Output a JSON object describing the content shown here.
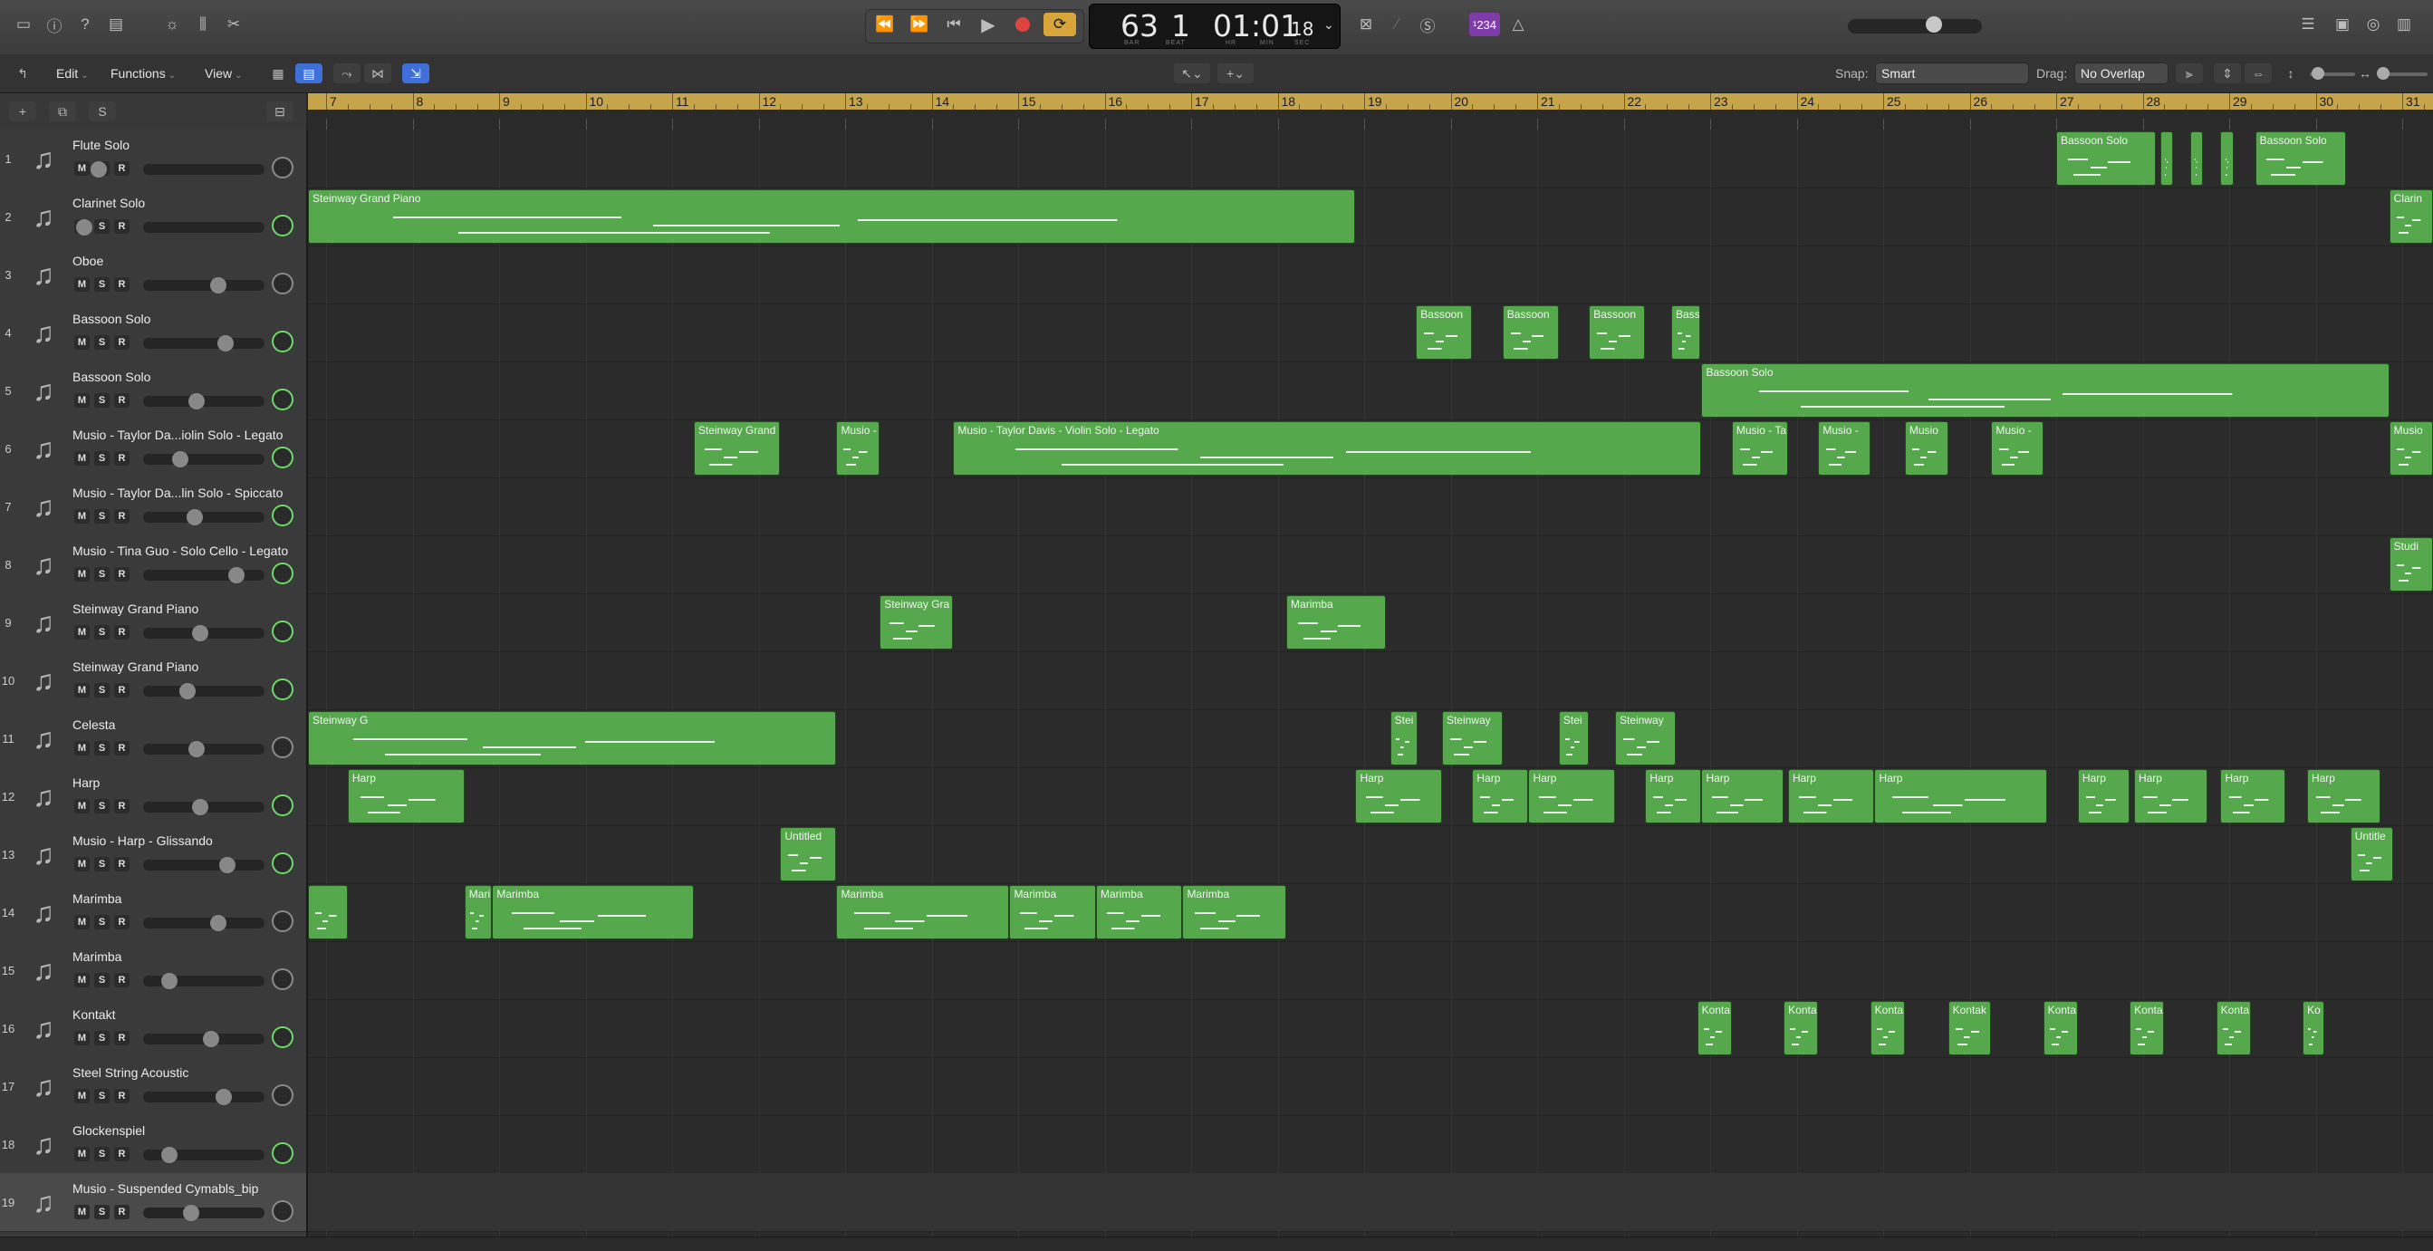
{
  "lcd": {
    "bar": "63",
    "beat": "1",
    "time": "01:01",
    "frames": "18",
    "labels": {
      "bar": "BAR",
      "beat": "BEAT",
      "hr": "HR",
      "min": "MIN",
      "sec": "SEC"
    }
  },
  "transport": {
    "signature_badge": "¹234"
  },
  "toolbar": {
    "edit_label": "Edit",
    "functions_label": "Functions",
    "view_label": "View",
    "snap_label": "Snap:",
    "snap_value": "Smart",
    "drag_label": "Drag:",
    "drag_value": "No Overlap"
  },
  "header_buttons": {
    "add": "+",
    "s": "S"
  },
  "ruler_bars": [
    "7",
    "8",
    "9",
    "10",
    "11",
    "12",
    "13",
    "14",
    "15",
    "16",
    "17",
    "18",
    "19",
    "20",
    "21",
    "22",
    "23",
    "24",
    "25",
    "26",
    "27",
    "28",
    "29",
    "30",
    "31"
  ],
  "tracks": [
    {
      "num": "1",
      "name": "Flute Solo",
      "icon": "flute-icon",
      "pan_active": false
    },
    {
      "num": "2",
      "name": "Clarinet Solo",
      "icon": "clarinet-icon",
      "pan_active": true
    },
    {
      "num": "3",
      "name": "Oboe",
      "icon": "oboe-icon",
      "pan_active": false
    },
    {
      "num": "4",
      "name": "Bassoon Solo",
      "icon": "bassoon-icon",
      "pan_active": true
    },
    {
      "num": "5",
      "name": "Bassoon Solo",
      "icon": "bassoon-icon",
      "pan_active": true
    },
    {
      "num": "6",
      "name": "Musio - Taylor Da...iolin Solo - Legato",
      "icon": "violin-icon",
      "pan_active": true
    },
    {
      "num": "7",
      "name": "Musio - Taylor Da...lin Solo - Spiccato",
      "icon": "violin-icon",
      "pan_active": true
    },
    {
      "num": "8",
      "name": "Musio - Tina Guo - Solo Cello - Legato",
      "icon": "cello-icon",
      "pan_active": true
    },
    {
      "num": "9",
      "name": "Steinway Grand Piano",
      "icon": "grand-piano-icon",
      "pan_active": true
    },
    {
      "num": "10",
      "name": "Steinway Grand Piano",
      "icon": "grand-piano-icon",
      "pan_active": true
    },
    {
      "num": "11",
      "name": "Celesta",
      "icon": "celesta-icon",
      "pan_active": false
    },
    {
      "num": "12",
      "name": "Harp",
      "icon": "harp-icon",
      "pan_active": true
    },
    {
      "num": "13",
      "name": "Musio - Harp - Glissando",
      "icon": "harp-icon",
      "pan_active": true
    },
    {
      "num": "14",
      "name": "Marimba",
      "icon": "marimba-icon",
      "pan_active": false
    },
    {
      "num": "15",
      "name": "Marimba",
      "icon": "marimba-icon",
      "pan_active": false
    },
    {
      "num": "16",
      "name": "Kontakt",
      "icon": "guitar-icon",
      "pan_active": true
    },
    {
      "num": "17",
      "name": "Steel String Acoustic",
      "icon": "acoustic-guitar-icon",
      "pan_active": false
    },
    {
      "num": "18",
      "name": "Glockenspiel",
      "icon": "glockenspiel-icon",
      "pan_active": true
    },
    {
      "num": "19",
      "name": "Musio - Suspended Cymabls_bip",
      "icon": "cymbal-icon",
      "pan_active": false
    }
  ],
  "msr": {
    "m": "M",
    "s": "S",
    "r": "R"
  },
  "regions": [
    {
      "track": 0,
      "start": 27.0,
      "end": 28.15,
      "label": "Bassoon Solo"
    },
    {
      "track": 0,
      "start": 28.2,
      "end": 28.35,
      "label": ""
    },
    {
      "track": 0,
      "start": 28.55,
      "end": 28.7,
      "label": ""
    },
    {
      "track": 0,
      "start": 28.9,
      "end": 29.05,
      "label": ""
    },
    {
      "track": 0,
      "start": 29.3,
      "end": 30.35,
      "label": "Bassoon Solo"
    },
    {
      "track": 1,
      "start": 6.72,
      "end": 18.9,
      "label": "Steinway Grand Piano"
    },
    {
      "track": 1,
      "start": 30.85,
      "end": 31.5,
      "label": "Clarin"
    },
    {
      "track": 3,
      "start": 19.6,
      "end": 20.25,
      "label": "Bassoon"
    },
    {
      "track": 3,
      "start": 20.6,
      "end": 21.25,
      "label": "Bassoon"
    },
    {
      "track": 3,
      "start": 21.6,
      "end": 22.25,
      "label": "Bassoon"
    },
    {
      "track": 3,
      "start": 22.55,
      "end": 22.88,
      "label": "Bass"
    },
    {
      "track": 4,
      "start": 22.9,
      "end": 30.85,
      "label": "Bassoon Solo"
    },
    {
      "track": 5,
      "start": 11.25,
      "end": 12.25,
      "label": "Steinway Grand"
    },
    {
      "track": 5,
      "start": 12.9,
      "end": 13.4,
      "label": "Musio -"
    },
    {
      "track": 5,
      "start": 14.25,
      "end": 22.9,
      "label": "Musio - Taylor Davis - Violin Solo - Legato"
    },
    {
      "track": 5,
      "start": 23.25,
      "end": 23.9,
      "label": "Musio - Ta"
    },
    {
      "track": 5,
      "start": 24.25,
      "end": 24.85,
      "label": "Musio -"
    },
    {
      "track": 5,
      "start": 25.25,
      "end": 25.75,
      "label": "Musio"
    },
    {
      "track": 5,
      "start": 26.25,
      "end": 26.85,
      "label": "Musio -"
    },
    {
      "track": 5,
      "start": 30.85,
      "end": 31.5,
      "label": "Musio"
    },
    {
      "track": 7,
      "start": 30.85,
      "end": 31.5,
      "label": "Studi"
    },
    {
      "track": 8,
      "start": 13.4,
      "end": 14.25,
      "label": "Steinway Gra"
    },
    {
      "track": 8,
      "start": 18.1,
      "end": 19.25,
      "label": "Marimba"
    },
    {
      "track": 10,
      "start": 6.72,
      "end": 12.9,
      "label": "Steinway G"
    },
    {
      "track": 10,
      "start": 19.3,
      "end": 19.62,
      "label": "Stei"
    },
    {
      "track": 10,
      "start": 19.9,
      "end": 20.6,
      "label": "Steinway"
    },
    {
      "track": 10,
      "start": 21.25,
      "end": 21.6,
      "label": "Stei"
    },
    {
      "track": 10,
      "start": 21.9,
      "end": 22.6,
      "label": "Steinway"
    },
    {
      "track": 11,
      "start": 7.25,
      "end": 8.6,
      "label": "Harp"
    },
    {
      "track": 11,
      "start": 18.9,
      "end": 19.9,
      "label": "Harp"
    },
    {
      "track": 11,
      "start": 20.25,
      "end": 20.9,
      "label": "Harp"
    },
    {
      "track": 11,
      "start": 20.9,
      "end": 21.9,
      "label": "Harp"
    },
    {
      "track": 11,
      "start": 22.25,
      "end": 22.9,
      "label": "Harp"
    },
    {
      "track": 11,
      "start": 22.9,
      "end": 23.85,
      "label": "Harp"
    },
    {
      "track": 11,
      "start": 23.9,
      "end": 24.9,
      "label": "Harp"
    },
    {
      "track": 11,
      "start": 24.9,
      "end": 26.9,
      "label": "Harp"
    },
    {
      "track": 11,
      "start": 27.25,
      "end": 27.85,
      "label": "Harp"
    },
    {
      "track": 11,
      "start": 27.9,
      "end": 28.75,
      "label": "Harp"
    },
    {
      "track": 11,
      "start": 28.9,
      "end": 29.65,
      "label": "Harp"
    },
    {
      "track": 11,
      "start": 29.9,
      "end": 30.75,
      "label": "Harp"
    },
    {
      "track": 12,
      "start": 12.25,
      "end": 12.9,
      "label": "Untitled"
    },
    {
      "track": 12,
      "start": 30.4,
      "end": 30.9,
      "label": "Untitle"
    },
    {
      "track": 13,
      "start": 6.72,
      "end": 7.25,
      "label": ""
    },
    {
      "track": 13,
      "start": 8.6,
      "end": 8.92,
      "label": "Mari"
    },
    {
      "track": 13,
      "start": 8.92,
      "end": 11.25,
      "label": "Marimba"
    },
    {
      "track": 13,
      "start": 12.9,
      "end": 14.9,
      "label": "Marimba"
    },
    {
      "track": 13,
      "start": 14.9,
      "end": 15.9,
      "label": "Marimba"
    },
    {
      "track": 13,
      "start": 15.9,
      "end": 16.9,
      "label": "Marimba"
    },
    {
      "track": 13,
      "start": 16.9,
      "end": 18.1,
      "label": "Marimba"
    },
    {
      "track": 15,
      "start": 22.85,
      "end": 23.25,
      "label": "Konta"
    },
    {
      "track": 15,
      "start": 23.85,
      "end": 24.25,
      "label": "Konta"
    },
    {
      "track": 15,
      "start": 24.85,
      "end": 25.25,
      "label": "Konta"
    },
    {
      "track": 15,
      "start": 25.75,
      "end": 26.25,
      "label": "Kontak"
    },
    {
      "track": 15,
      "start": 26.85,
      "end": 27.25,
      "label": "Konta"
    },
    {
      "track": 15,
      "start": 27.85,
      "end": 28.25,
      "label": "Konta"
    },
    {
      "track": 15,
      "start": 28.85,
      "end": 29.25,
      "label": "Konta"
    },
    {
      "track": 15,
      "start": 29.85,
      "end": 30.1,
      "label": "Ko"
    }
  ],
  "colors": {
    "region": "#56a84c",
    "ruler": "#c6a44a",
    "pan_active": "#6bd86b",
    "record": "#e0443e",
    "cycle": "#d8a53a",
    "badge": "#7e3ca8"
  }
}
